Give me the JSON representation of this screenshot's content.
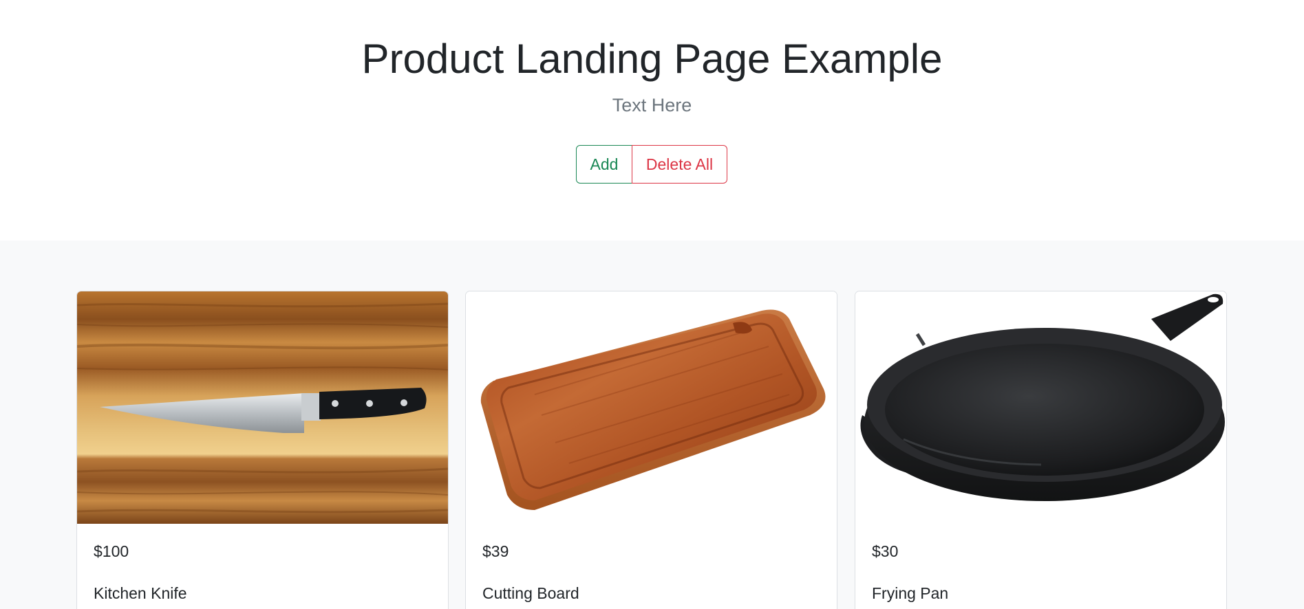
{
  "header": {
    "title": "Product Landing Page Example",
    "subtitle": "Text Here"
  },
  "actions": {
    "add_label": "Add",
    "delete_all_label": "Delete All"
  },
  "products": [
    {
      "price": "$100",
      "name": "Kitchen Knife"
    },
    {
      "price": "$39",
      "name": "Cutting Board"
    },
    {
      "price": "$30",
      "name": "Frying Pan"
    }
  ],
  "colors": {
    "add": "#198754",
    "delete": "#dc3545",
    "section_bg": "#f8f9fa"
  }
}
